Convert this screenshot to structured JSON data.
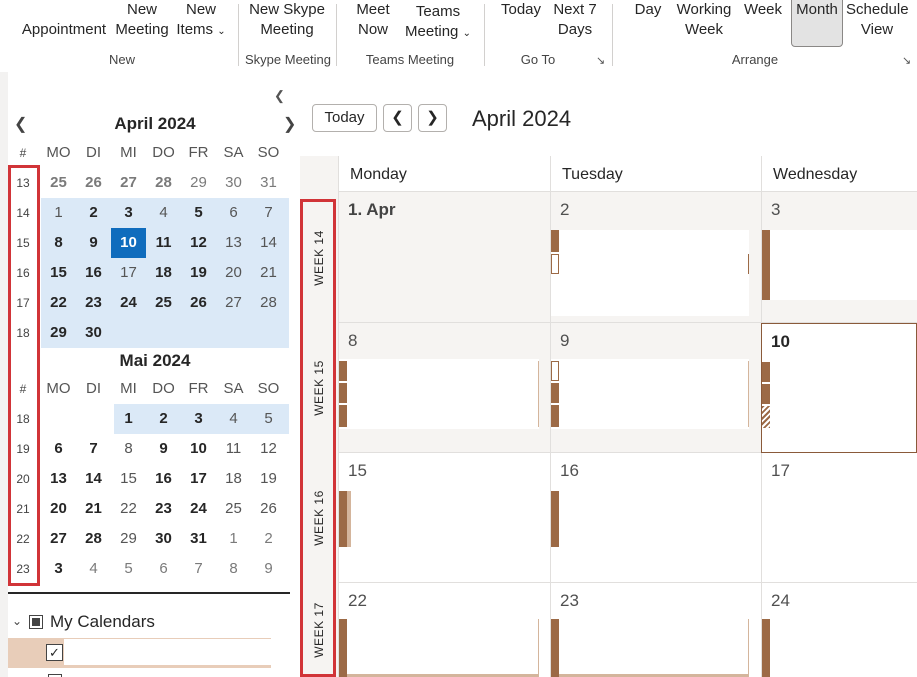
{
  "ribbon": {
    "new_appointment": "Appointment",
    "new_meeting": "New Meeting",
    "new_items": "New Items",
    "new_skype_meeting": "New Skype Meeting",
    "meet_now": "Meet Now",
    "teams_meeting": "Teams Meeting",
    "today": "Today",
    "next7_line1": "Next 7",
    "next7_line2": "Days",
    "day": "Day",
    "working_week": "Working Week",
    "week": "Week",
    "month": "Month",
    "schedule_view": "Schedule View",
    "group_new": "New",
    "group_skype": "Skype Meeting",
    "group_teams": "Teams Meeting",
    "group_goto": "Go To",
    "group_arrange": "Arrange"
  },
  "date_picker": {
    "week_header": "#",
    "weekdays": [
      "MO",
      "DI",
      "MI",
      "DO",
      "FR",
      "SA",
      "SO"
    ],
    "april": {
      "title": "April 2024",
      "weeks": [
        {
          "wk": "13",
          "days": [
            "25",
            "26",
            "27",
            "28",
            "29",
            "30",
            "31"
          ]
        },
        {
          "wk": "14",
          "days": [
            "1",
            "2",
            "3",
            "4",
            "5",
            "6",
            "7"
          ]
        },
        {
          "wk": "15",
          "days": [
            "8",
            "9",
            "10",
            "11",
            "12",
            "13",
            "14"
          ]
        },
        {
          "wk": "16",
          "days": [
            "15",
            "16",
            "17",
            "18",
            "19",
            "20",
            "21"
          ]
        },
        {
          "wk": "17",
          "days": [
            "22",
            "23",
            "24",
            "25",
            "26",
            "27",
            "28"
          ]
        },
        {
          "wk": "18",
          "days": [
            "29",
            "30",
            "",
            "",
            "",
            "",
            ""
          ]
        }
      ]
    },
    "may": {
      "title": "Mai 2024",
      "weeks": [
        {
          "wk": "18",
          "days": [
            "",
            "",
            "1",
            "2",
            "3",
            "4",
            "5"
          ]
        },
        {
          "wk": "19",
          "days": [
            "6",
            "7",
            "8",
            "9",
            "10",
            "11",
            "12"
          ]
        },
        {
          "wk": "20",
          "days": [
            "13",
            "14",
            "15",
            "16",
            "17",
            "18",
            "19"
          ]
        },
        {
          "wk": "21",
          "days": [
            "20",
            "21",
            "22",
            "23",
            "24",
            "25",
            "26"
          ]
        },
        {
          "wk": "22",
          "days": [
            "27",
            "28",
            "29",
            "30",
            "31",
            "1",
            "2"
          ]
        },
        {
          "wk": "23",
          "days": [
            "3",
            "4",
            "5",
            "6",
            "7",
            "8",
            "9"
          ]
        }
      ]
    }
  },
  "calendars": {
    "section_label": "My Calendars"
  },
  "main": {
    "today_button": "Today",
    "title": "April 2024",
    "day_headers": [
      "Monday",
      "Tuesday",
      "Wednesday"
    ],
    "week_labels": [
      "WEEK 14",
      "WEEK 15",
      "WEEK 16",
      "WEEK 17"
    ],
    "rows": [
      [
        "1. Apr",
        "2",
        "3"
      ],
      [
        "8",
        "9",
        "10"
      ],
      [
        "15",
        "16",
        "17"
      ],
      [
        "22",
        "23",
        "24"
      ]
    ]
  },
  "colors": {
    "accent_blue": "#0f6cbd",
    "selection_blue": "#dbe9f7",
    "appointment_brown": "#9c6a46",
    "highlight_red": "#d13438"
  }
}
